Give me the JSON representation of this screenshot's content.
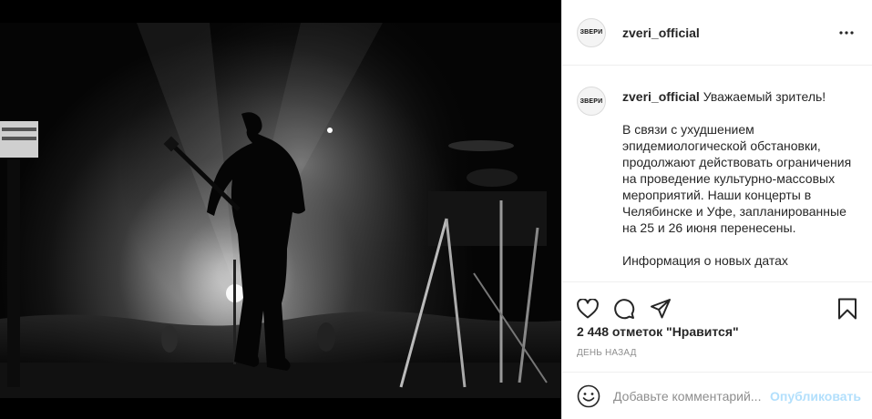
{
  "post": {
    "username": "zveri_official",
    "avatar_text": "ЗВЕРИ"
  },
  "caption": {
    "username": "zveri_official",
    "greeting": "Уважаемый зритель!",
    "paragraph": "В связи с ухудшением эпидемиологической обстановки, продолжают действовать ограничения на проведение культурно-массовых мероприятий. Наши концерты в Челябинске и Уфе, запланированные на 25 и 26 июня перенесены.",
    "next_line": "Информация о новых датах"
  },
  "actions": {
    "like_icon": "heart-icon",
    "comment_icon": "comment-icon",
    "share_icon": "share-icon",
    "save_icon": "bookmark-icon"
  },
  "likes_text": "2 448 отметок \"Нравится\"",
  "date_text": "День назад",
  "add_comment": {
    "placeholder": "Добавьте комментарий...",
    "post_label": "Опубликовать",
    "emoji_icon": "smiley-icon"
  },
  "colors": {
    "link_disabled": "#b2dffc",
    "text": "#262626",
    "muted": "#8e8e8e",
    "border": "#efefef"
  }
}
